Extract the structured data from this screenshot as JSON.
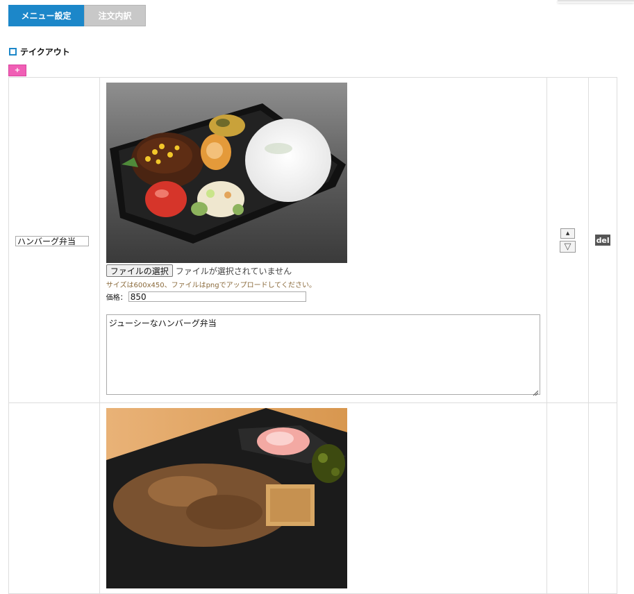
{
  "tabs": [
    {
      "label": "メニュー設定",
      "active": true
    },
    {
      "label": "注文内訳",
      "active": false
    }
  ],
  "section": {
    "title": "テイクアウト"
  },
  "add_button": {
    "label": "+"
  },
  "colors": {
    "accent": "#1c87c9",
    "add_button": "#f05fb5",
    "tab_inactive": "#c8c8c8"
  },
  "items": [
    {
      "name": "ハンバーグ弁当",
      "image_icon": "hamburg-bento-photo",
      "file_button": "ファイルの選択",
      "file_status": "ファイルが選択されていません",
      "size_note": "サイズは600x450、ファイルはpngでアップロードしてください。",
      "price_label": "価格：",
      "price": "850",
      "description": "ジューシーなハンバーグ弁当",
      "move_up": "▲",
      "move_down": "▽",
      "delete": "del"
    },
    {
      "name": "",
      "image_icon": "gyudon-bento-photo"
    }
  ]
}
